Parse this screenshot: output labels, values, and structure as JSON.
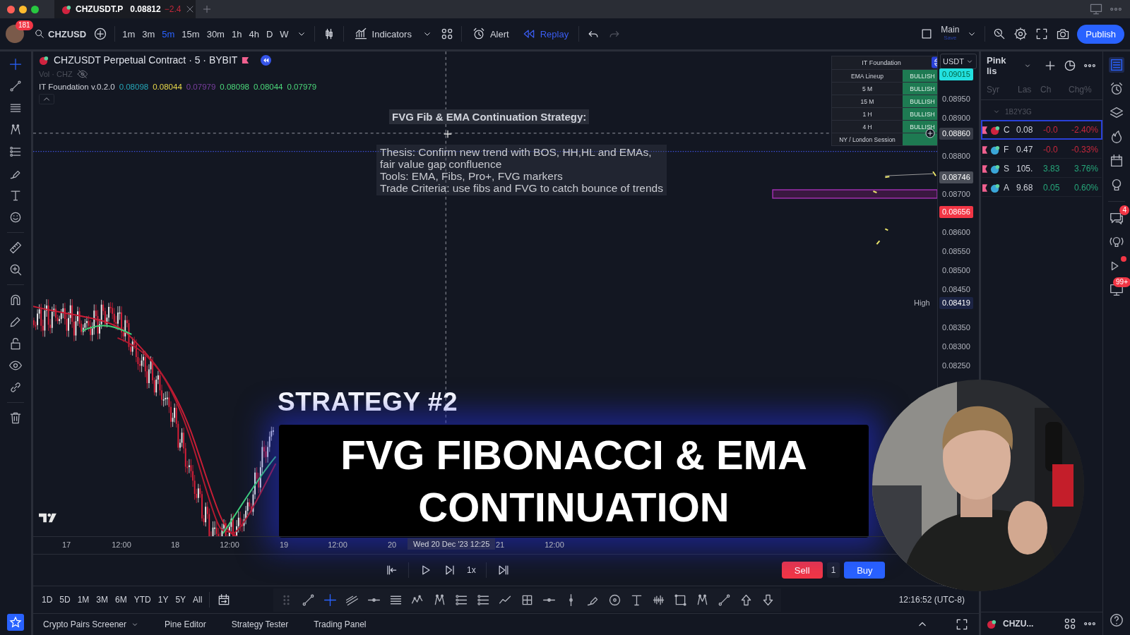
{
  "window_tab": {
    "title": "CHZUSDT.P",
    "price": "0.08812",
    "change": "−2.4"
  },
  "toolbar": {
    "notification_count": "181",
    "symbol": "CHZUSD",
    "intervals": [
      {
        "label": "1m",
        "selected": false
      },
      {
        "label": "3m",
        "selected": false
      },
      {
        "label": "5m",
        "selected": true
      },
      {
        "label": "15m",
        "selected": false
      },
      {
        "label": "30m",
        "selected": false
      },
      {
        "label": "1h",
        "selected": false
      },
      {
        "label": "4h",
        "selected": false
      },
      {
        "label": "D",
        "selected": false
      },
      {
        "label": "W",
        "selected": false
      }
    ],
    "indicators": "Indicators",
    "alert": "Alert",
    "replay": {
      "label": "Replay",
      "active": true
    },
    "layout": {
      "name": "Main",
      "status": "Save"
    },
    "publish": "Publish"
  },
  "chart": {
    "legend": {
      "title": "CHZUSDT Perpetual Contract · 5 · BYBIT",
      "volume": "Vol · CHZ",
      "indicator": "IT Foundation v.0.2.0",
      "values": [
        {
          "text": "0.08098",
          "color": "#26a6b8"
        },
        {
          "text": "0.08044",
          "color": "#e8d84a"
        },
        {
          "text": "0.07979",
          "color": "#7b3fa0"
        },
        {
          "text": "0.08098",
          "color": "#4cd97b"
        },
        {
          "text": "0.08044",
          "color": "#4cd97b"
        },
        {
          "text": "0.07979",
          "color": "#4cd97b"
        }
      ]
    },
    "note": {
      "title": "FVG Fib & EMA Continuation Strategy:",
      "lines": [
        "Thesis: Confirm new trend with BOS, HH,HL and EMAs,",
        "fair value gap confluence",
        "Tools: EMA, Fibs, Pro+, FVG markers",
        "Trade Criteria: use fibs and FVG to catch bounce of trends"
      ]
    },
    "status_table": {
      "title": "IT Foundation",
      "rows": [
        {
          "label": "EMA Lineup",
          "value": "BULLISH"
        },
        {
          "label": "5 M",
          "value": "BULLISH"
        },
        {
          "label": "15 M",
          "value": "BULLISH"
        },
        {
          "label": "1 H",
          "value": "BULLISH"
        },
        {
          "label": "4 H",
          "value": "BULLISH"
        },
        {
          "label": "NY / London Session"
        }
      ]
    },
    "currency": "USDT",
    "price_ticks": [
      "0.08950",
      "0.08900",
      "0.08800",
      "0.08700",
      "0.08600",
      "0.08550",
      "0.08500",
      "0.08450",
      "0.08350",
      "0.08300",
      "0.08250"
    ],
    "price_tags": [
      {
        "text": "0.09015",
        "color": "#22e0e0"
      },
      {
        "text": "0.08860",
        "color": "#363a45"
      },
      {
        "text": "0.08746",
        "color": "#4a4e58"
      },
      {
        "text": "0.08656",
        "color": "#f23645"
      },
      {
        "text": "0.08419",
        "color": "#1c2444",
        "label": "High"
      }
    ],
    "time_labels": [
      "17",
      "12:00",
      "18",
      "12:00",
      "19",
      "12:00",
      "20",
      "21",
      "12:00"
    ],
    "crosshair_time": "Wed 20 Dec '23  12:25"
  },
  "overlay": {
    "subtitle": "STRATEGY #2",
    "title_lines": [
      "FVG FIBONACCI & EMA",
      "CONTINUATION"
    ]
  },
  "replay_controls": {
    "speed": "1x"
  },
  "trade": {
    "sell": "Sell",
    "quantity": "1",
    "buy": "Buy"
  },
  "timeframes": [
    "1D",
    "5D",
    "1M",
    "3M",
    "6M",
    "YTD",
    "1Y",
    "5Y",
    "All"
  ],
  "clock": "12:16:52 (UTC-8)",
  "bottom_tabs": [
    "Crypto Pairs Screener",
    "Pine Editor",
    "Strategy Tester",
    "Trading Panel"
  ],
  "watchlist": {
    "title": "Pink lis",
    "columns": [
      "Syr",
      "Las",
      "Ch",
      "Chg%"
    ],
    "group": "1B2Y3G",
    "rows": [
      {
        "symbol": "C",
        "last": "0.08",
        "change": "-0.0",
        "change_pct": "-2.40%",
        "color": "#c8283c",
        "selected": true
      },
      {
        "symbol": "F",
        "last": "0.47",
        "change": "-0.0",
        "change_pct": "-0.33%",
        "color": "#c8283c",
        "selected": false
      },
      {
        "symbol": "S",
        "last": "105.",
        "change": "3.83",
        "change_pct": "3.76%",
        "color": "#26a67a",
        "selected": false
      },
      {
        "symbol": "A",
        "last": "9.68",
        "change": "0.05",
        "change_pct": "0.60%",
        "color": "#26a67a",
        "selected": false
      }
    ],
    "footer_symbol": "CHZU..."
  },
  "sidebar_badges": {
    "chat": "4",
    "alerts": "99+"
  }
}
